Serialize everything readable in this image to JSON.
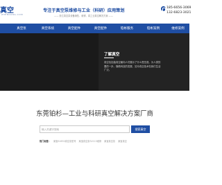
{
  "header": {
    "logo_text": "真空",
    "logo_sub": "ZHENKONG.COM",
    "slogan_title": "专注于真空泵维修与工业（科研）应用策划",
    "slogan_sub": "—— 浙江真空泵设备销售、维修、真工业真空解决方案 ——",
    "phone_1": "185-6656-3069",
    "phone_2": "132-6823-3021"
  },
  "nav": {
    "items": [
      {
        "label": ""
      },
      {
        "label": "真空泵"
      },
      {
        "label": "真空系统"
      },
      {
        "label": "真空配件"
      },
      {
        "label": "真空配件"
      },
      {
        "label": "铂彬服务"
      },
      {
        "label": "铂彬案例"
      },
      {
        "label": "维修案例"
      }
    ]
  },
  "banner": {
    "title": "了解真空",
    "desc_lines": [
      "真空包括抽真空最向人们展示了什么是压强，为人类的",
      "要的一步。随着科技的发展，如今真空技术在我们生活",
      "广泛。"
    ]
  },
  "main": {
    "title": "东莞铂杉—工业与科研真空解决方案厂商",
    "search_placeholder": "输入关键字搜索",
    "search_button": "搜索真空",
    "hot_label": "热门标签：",
    "hot_tags": [
      "莱宝SV630真空泵型号",
      "莱宝真空泵SV115维修",
      "莱宝真空泵",
      "莱宝真空"
    ]
  },
  "colors": {
    "brand": "#1f4ea3",
    "banner_bg": "#1f1f1f"
  }
}
